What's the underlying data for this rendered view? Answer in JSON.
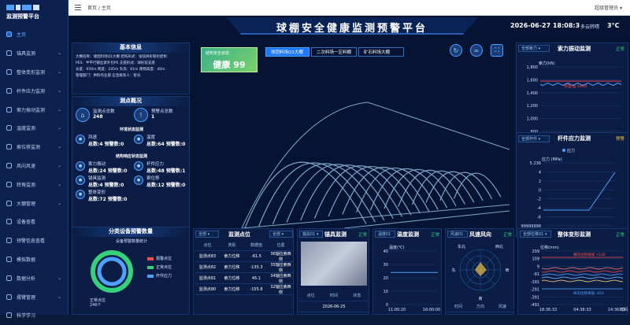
{
  "app": {
    "name": "监测预警平台"
  },
  "sidebar": {
    "items": [
      {
        "label": "主页",
        "active": true,
        "expandable": false
      },
      {
        "label": "锚具监测",
        "expandable": true
      },
      {
        "label": "整体变形监测",
        "expandable": true
      },
      {
        "label": "杆件应力监测",
        "expandable": true
      },
      {
        "label": "索力振动监测",
        "expandable": true
      },
      {
        "label": "温度监测",
        "expandable": true
      },
      {
        "label": "索位移监测",
        "expandable": true
      },
      {
        "label": "风向风速",
        "expandable": true
      },
      {
        "label": "转角监测",
        "expandable": true
      },
      {
        "label": "大棚管理",
        "expandable": true
      },
      {
        "label": "设备查看",
        "expandable": false
      },
      {
        "label": "预警信息查看",
        "expandable": false
      },
      {
        "label": "模拟数据",
        "expandable": false
      },
      {
        "label": "数据分析",
        "expandable": true
      },
      {
        "label": "摆臂管理",
        "expandable": true
      },
      {
        "label": "科学学习",
        "expandable": false
      }
    ]
  },
  "topbar": {
    "breadcrumb_home": "首页",
    "breadcrumb_current": "主页",
    "user": "超级管理员 ▾"
  },
  "header": {
    "title": "球棚安全健康监测预警平台",
    "datetime": "2026-06-27 18:08:3",
    "weather": "多云转晴",
    "temperature": "3°C"
  },
  "basic_info": {
    "title": "基本信息",
    "lines": [
      "大棚名称：球团料场Q1大棚   结构形式：张弦拱形管桁结构",
      "PES：半平行钢丝索外包PE   支座形式：球形铰支座",
      "长度：650m  跨度：245m  矢高：61m  南侧高度：40m",
      "管理部门：供料作业部   应急联系人：智光"
    ]
  },
  "measure_overview": {
    "title": "测点概况",
    "total_label": "监测点总数",
    "total": "248",
    "warn_label": "预警点总数",
    "warn": "1",
    "env_title": "环境状态监测",
    "struct_title": "结构响应状态监测",
    "env": [
      {
        "name": "风速",
        "summary": "总数:4 预警数:0"
      },
      {
        "name": "温度",
        "summary": "总数:64 预警数:0"
      }
    ],
    "struct": [
      {
        "name": "索力振动",
        "summary": "总数:24 预警数:0"
      },
      {
        "name": "杆件应力",
        "summary": "总数:48 预警数:1"
      },
      {
        "name": "锚具监测",
        "summary": "总数:4 预警数:0"
      },
      {
        "name": "索位移",
        "summary": "总数:12 预警数:0"
      },
      {
        "name": "整体变形",
        "summary": "总数:72 预警数:0"
      }
    ],
    "north": "北"
  },
  "health": {
    "label": "结构安全状态",
    "value": "健康 99"
  },
  "building_tabs": [
    {
      "label": "球团料场Q1大棚",
      "active": true
    },
    {
      "label": "二次料场一区料棚",
      "active": false
    },
    {
      "label": "矿石料场大棚",
      "active": false
    }
  ],
  "cable_vibration": {
    "selector": "全部索力  ▾",
    "title": "索力振动监测",
    "status": "正常",
    "ylabel": "索力(kN)",
    "legend": "预警值:1800",
    "xlabel": "时间",
    "y_ticks": [
      "1,800",
      "1,600",
      "1,400",
      "1,200",
      "1,000",
      "800"
    ],
    "x_ticks": [
      "18:37:02",
      "04:36:46",
      "14:36:43"
    ]
  },
  "member_stress": {
    "selector": "全部杆件  ▾",
    "title": "杆件应力监测",
    "status": "预警",
    "ylabel": "应力 (MPa)",
    "legend": "应力",
    "xlabel": "时间",
    "y_ticks": [
      "5.236",
      "4",
      "2",
      "0",
      "-2",
      "-4",
      "-6",
      "99999996"
    ],
    "x_ticks": [
      "11:33:44",
      "14:22:52",
      "16:15:32"
    ]
  },
  "device_warning": {
    "title": "分类设备预警数量",
    "subtitle": "设备预警数量统计",
    "legend": [
      "报警点位",
      "正常点位",
      "杆件应力"
    ],
    "center": "正常点位\n246个",
    "label": "杆件应力"
  },
  "monitor_points": {
    "selector": "全部  ▾",
    "title": "监测点位",
    "selector2": "全部  ▾",
    "headers": [
      "点位",
      "类别",
      "数据值",
      "位置"
    ],
    "rows": [
      {
        "point": "监测点83",
        "type": "索力位移",
        "value": "-61.5",
        "pos": "36轴拉索西侧"
      },
      {
        "point": "监测点82",
        "type": "索力位移",
        "value": "-135.3",
        "pos": "35轴拉索西侧"
      },
      {
        "point": "监测点81",
        "type": "索力位移",
        "value": "45.1",
        "pos": "34轴拉索西侧"
      },
      {
        "point": "监测点80",
        "type": "索力位移",
        "value": "-155.8",
        "pos": "32轴拉索西侧"
      }
    ]
  },
  "anchor": {
    "selector": "锚具01  ▾",
    "title": "锚具监测",
    "status": "正常",
    "headers": [
      "点位",
      "时间",
      "状态"
    ],
    "row": [
      "",
      "2026-06-25",
      ""
    ]
  },
  "temperature": {
    "selector": "温度01",
    "title": "温度监测",
    "status": "正常",
    "ylabel": "温度(℃)",
    "y_ticks": [
      "40",
      "30",
      "20",
      "10",
      "0"
    ],
    "x_ticks": [
      "11:00:20",
      "16:00:00"
    ]
  },
  "wind": {
    "selector": "风速01",
    "title": "风速风向",
    "status": "正常",
    "dirs": [
      "东北",
      "西北",
      "东",
      "西",
      "南"
    ],
    "headers": [
      "时间",
      "方向",
      "风速"
    ]
  },
  "overall_deform": {
    "selector": "全部位移01  ▾",
    "title": "整体变形监测",
    "status": "正常",
    "ylabel": "位移(mm)",
    "legend_up": "横向位移阈值 +145",
    "legend_down": "纵向位移阈值 -453",
    "y_ticks": [
      "209",
      "109",
      "9",
      "-91",
      "-191",
      "-291",
      "-391",
      "-491"
    ],
    "x_ticks": [
      "18:36:33",
      "04:36:33",
      "14:36:33"
    ],
    "xlabel": "时间"
  },
  "colors": {
    "accent": "#1e78ff",
    "ok": "#36d07a",
    "warn": "#f0c040",
    "alarm": "#ff4d4f"
  }
}
